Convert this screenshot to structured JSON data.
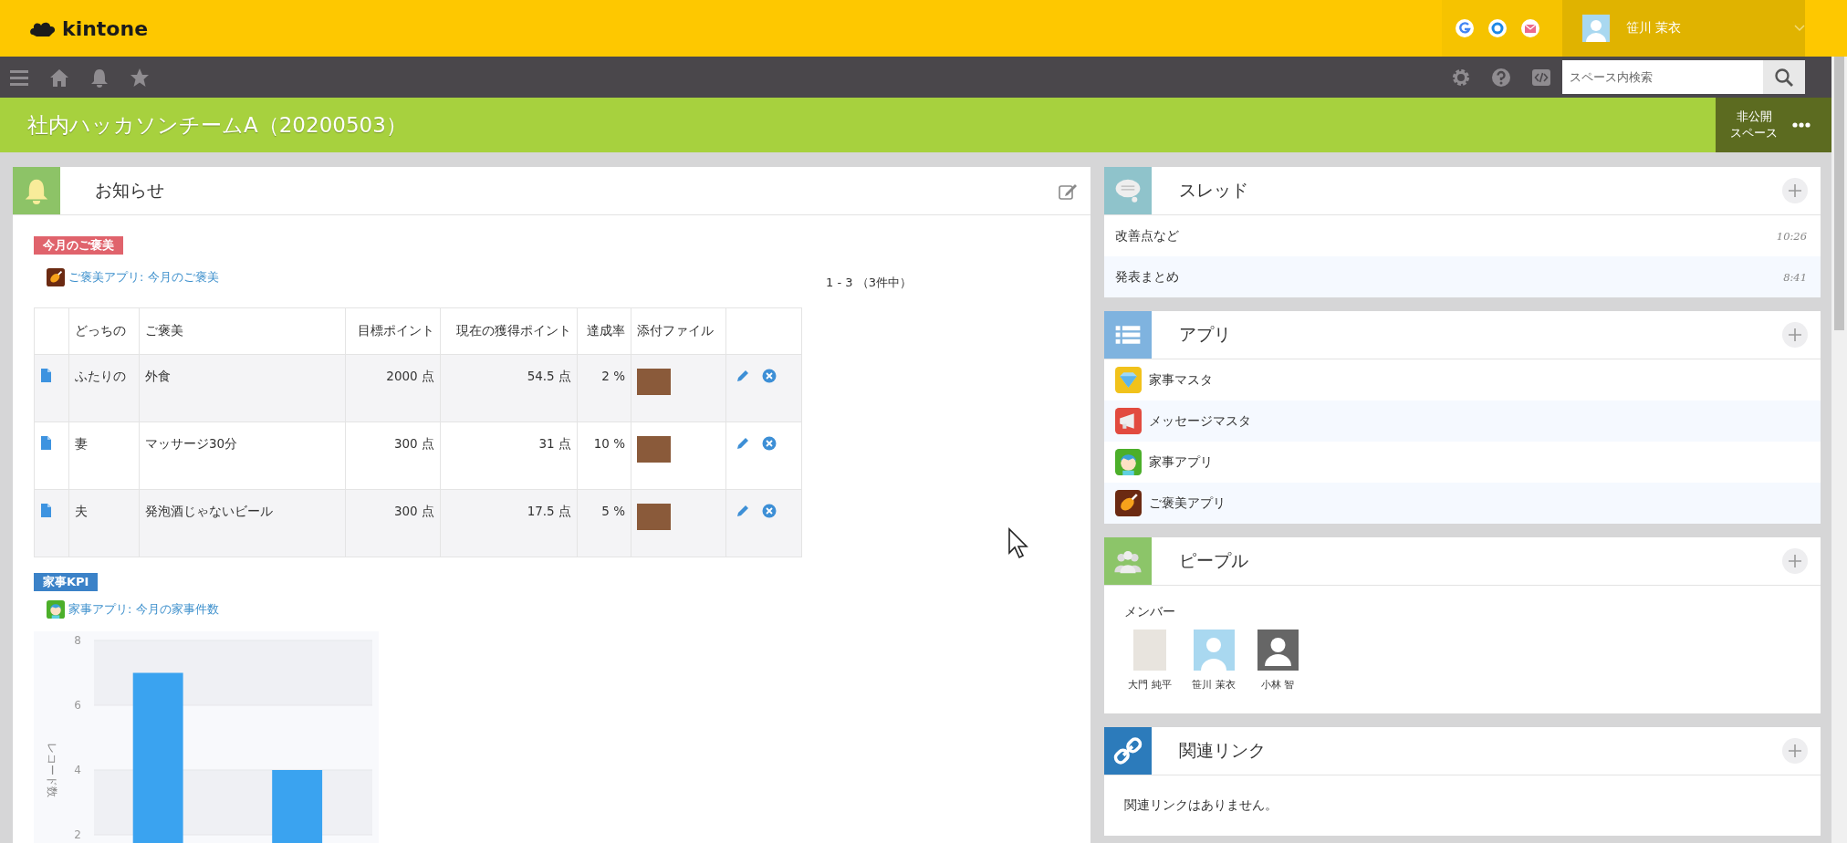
{
  "header": {
    "logo": "kintone",
    "user_name": "笹川 茉衣"
  },
  "navbar": {
    "search": {
      "placeholder": "スペース内検索"
    }
  },
  "space": {
    "title": "社内ハッカソンチームA（20200503）",
    "visibility_badge": [
      "非公開",
      "スペース"
    ]
  },
  "notice": {
    "title": "お知らせ",
    "sections": [
      {
        "kind": "table",
        "tag": {
          "text": "今月のご褒美",
          "color": "#e0636c"
        },
        "app": {
          "kind": "meat",
          "link": "ご褒美アプリ: 今月のご褒美"
        },
        "pagination": "1 - 3 （3件中）",
        "table": {
          "columns": [
            "どっちの",
            "ご褒美",
            "目標ポイント",
            "現在の獲得ポイント",
            "達成率",
            "添付ファイル"
          ],
          "rows": [
            [
              "ふたりの",
              "外食",
              "2000 点",
              "54.5 点",
              "2 %"
            ],
            [
              "妻",
              "マッサージ30分",
              "300 点",
              "31 点",
              "10 %"
            ],
            [
              "夫",
              "発泡酒じゃないビール",
              "300 点",
              "17.5 点",
              "5 %"
            ]
          ]
        }
      },
      {
        "kind": "chart",
        "tag": {
          "text": "家事KPI",
          "color": "#3b82c8"
        },
        "app": {
          "kind": "child",
          "link": "家事アプリ: 今月の家事件数"
        },
        "chart_data": {
          "type": "bar",
          "grid": true,
          "ylabel": "レコード数",
          "ylim": [
            0,
            8
          ],
          "yticks": [
            2,
            4,
            6,
            8
          ],
          "series": [
            {
              "color": "#3aa3f0",
              "values": [
                7,
                4
              ]
            }
          ]
        }
      }
    ]
  },
  "side_panels": [
    {
      "kind": "threads",
      "title": "スレッド",
      "items": [
        {
          "title": "改善点など",
          "time": "10:26"
        },
        {
          "title": "発表まとめ",
          "time": "8:41"
        }
      ]
    },
    {
      "kind": "apps",
      "title": "アプリ",
      "items": [
        {
          "name": "家事マスタ",
          "kind": "diamond"
        },
        {
          "name": "メッセージマスタ",
          "kind": "megaphone"
        },
        {
          "name": "家事アプリ",
          "kind": "child"
        },
        {
          "name": "ご褒美アプリ",
          "kind": "meat"
        }
      ]
    },
    {
      "kind": "people",
      "title": "ピープル",
      "label": "メンバー",
      "members": [
        {
          "name": "大門 純平",
          "kind": "photo"
        },
        {
          "name": "笹川 茉衣",
          "kind": "illustration"
        },
        {
          "name": "小林 智",
          "kind": "silhouette"
        }
      ]
    },
    {
      "kind": "links",
      "title": "関連リンク",
      "empty_text": "関連リンクはありません。"
    }
  ]
}
